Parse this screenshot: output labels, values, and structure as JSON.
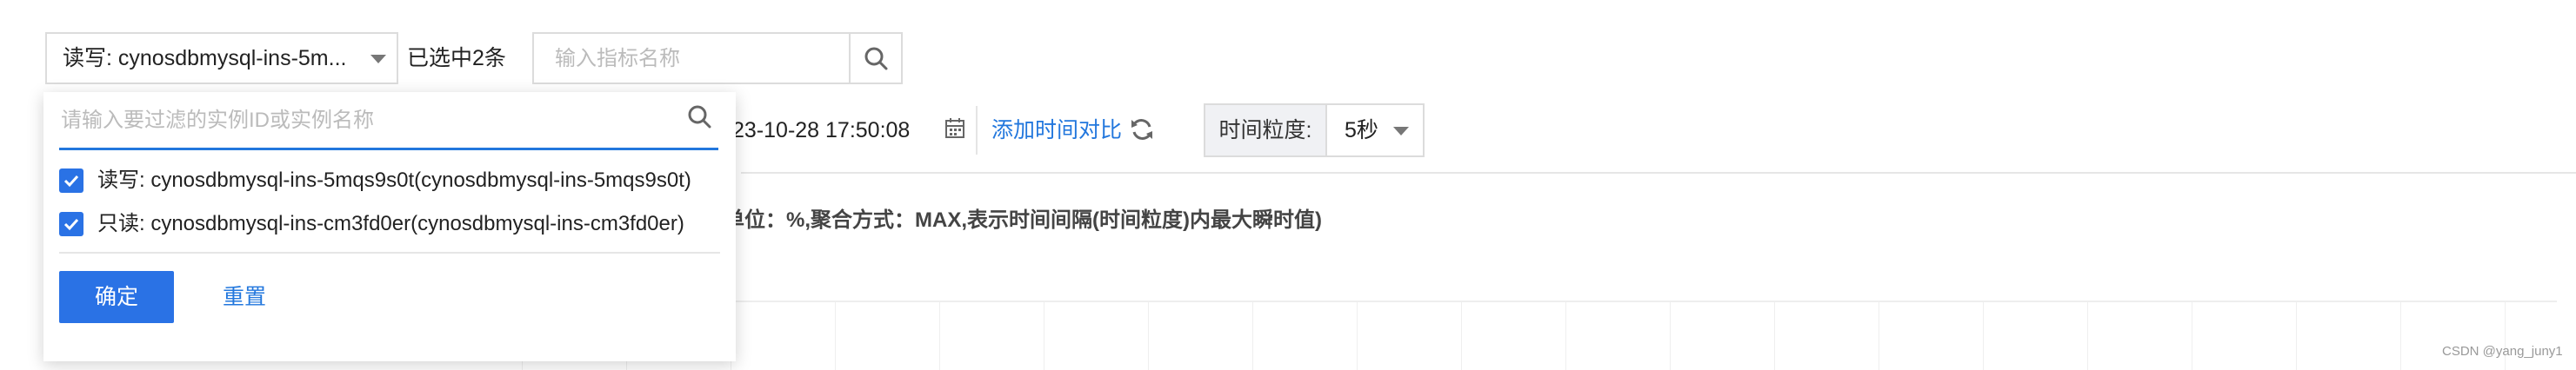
{
  "top_bar": {
    "instance_select_value": "读写: cynosdbmysql-ins-5m...",
    "selected_count": "已选中2条",
    "metric_search_placeholder": "输入指标名称"
  },
  "time_row": {
    "time_value": "23-10-28 17:50:08",
    "add_compare_label": "添加时间对比",
    "granularity_label": "时间粒度:",
    "granularity_value": "5秒"
  },
  "metric_description": "单位：%,聚合方式：MAX,表示时间间隔(时间粒度)内最大瞬时值)",
  "dropdown": {
    "filter_placeholder": "请输入要过滤的实例ID或实例名称",
    "options": [
      {
        "label": "读写: cynosdbmysql-ins-5mqs9s0t(cynosdbmysql-ins-5mqs9s0t)",
        "checked": true
      },
      {
        "label": "只读: cynosdbmysql-ins-cm3fd0er(cynosdbmysql-ins-cm3fd0er)",
        "checked": true
      }
    ],
    "confirm_label": "确定",
    "reset_label": "重置"
  },
  "watermark": "CSDN @yang_juny1",
  "colors": {
    "accent": "#2a72e5",
    "link": "#2277dd",
    "border": "#dcdcdc"
  },
  "icons": [
    "chevron-down-icon",
    "search-icon",
    "calendar-icon",
    "refresh-icon",
    "checkbox-checked-icon"
  ]
}
